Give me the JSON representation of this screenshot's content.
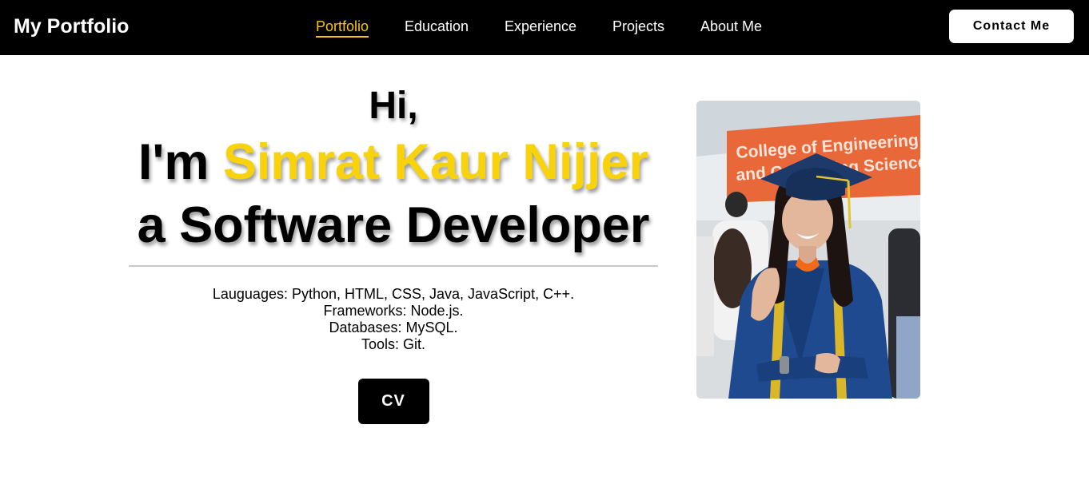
{
  "nav": {
    "brand": "My Portfolio",
    "links": [
      {
        "label": "Portfolio",
        "active": true
      },
      {
        "label": "Education",
        "active": false
      },
      {
        "label": "Experience",
        "active": false
      },
      {
        "label": "Projects",
        "active": false
      },
      {
        "label": "About Me",
        "active": false
      }
    ],
    "contact_label": "Contact Me"
  },
  "hero": {
    "greeting": "Hi,",
    "name_prefix": "I'm ",
    "name": "Simrat Kaur Nijjer",
    "role": "a Software Developer",
    "skills": [
      "Lauguages: Python, HTML, CSS, Java, JavaScript, C++.",
      "Frameworks: Node.js.",
      "Databases: MySQL.",
      "Tools: Git."
    ],
    "cv_label": "CV"
  },
  "photo": {
    "banner_line1": "College of Engineering",
    "banner_line2": "and Computing Science"
  },
  "colors": {
    "accent": "#f8d20a",
    "nav_bg": "#000000",
    "banner": "#e8683a",
    "gown": "#1f4a8f"
  }
}
